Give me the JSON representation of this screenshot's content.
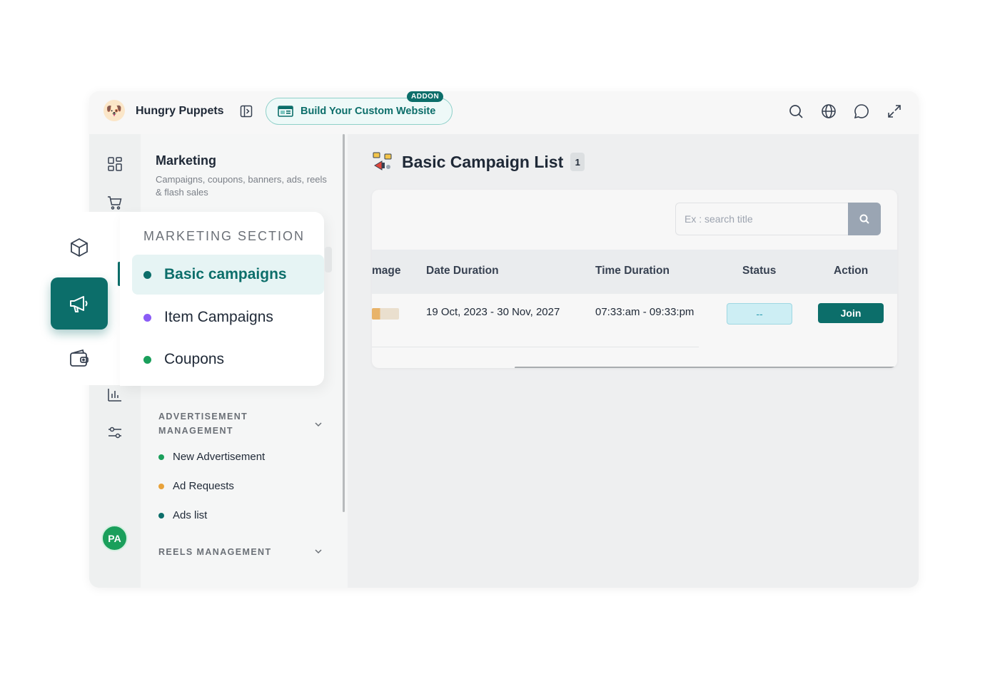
{
  "header": {
    "app_name": "Hungry Puppets",
    "build_button_label": "Build Your Custom Website",
    "addon_badge": "ADDON"
  },
  "sidebar_panel": {
    "title": "Marketing",
    "subtitle": "Campaigns, coupons, banners, ads, reels & flash sales",
    "sections": [
      {
        "label": "ADVERTISEMENT MANAGEMENT",
        "items": [
          {
            "label": "New Advertisement",
            "dot_color": "#1a9f5b"
          },
          {
            "label": "Ad Requests",
            "dot_color": "#e8a23a"
          },
          {
            "label": "Ads list",
            "dot_color": "#0c6e6a"
          }
        ]
      },
      {
        "label": "REELS MANAGEMENT",
        "items": []
      }
    ]
  },
  "marketing_popout": {
    "heading": "MARKETING SECTION",
    "items": [
      {
        "label": "Basic campaigns",
        "dot_color": "#0c6e6a",
        "active": true
      },
      {
        "label": "Item Campaigns",
        "dot_color": "#8b5cf6",
        "active": false
      },
      {
        "label": "Coupons",
        "dot_color": "#1a9f5b",
        "active": false
      }
    ]
  },
  "user": {
    "initials": "PA"
  },
  "main": {
    "title": "Basic Campaign List",
    "count": "1",
    "search_placeholder": "Ex : search title",
    "table": {
      "columns": [
        "mage",
        "Date Duration",
        "Time Duration",
        "Status",
        "Action"
      ],
      "rows": [
        {
          "date_duration": "19 Oct, 2023 - 30 Nov, 2027",
          "time_duration": "07:33:am - 09:33:pm",
          "status": "--",
          "action": "Join"
        }
      ]
    }
  },
  "colors": {
    "brand": "#0c6e6a",
    "status_bg": "#cdeef4"
  },
  "icons": {
    "rail": [
      "dashboard-icon",
      "cart-icon",
      "box-icon",
      "megaphone-icon",
      "wallet-icon",
      "chart-icon",
      "settings-sliders-icon"
    ],
    "top": [
      "search-icon",
      "globe-icon",
      "chat-icon",
      "expand-icon"
    ]
  }
}
